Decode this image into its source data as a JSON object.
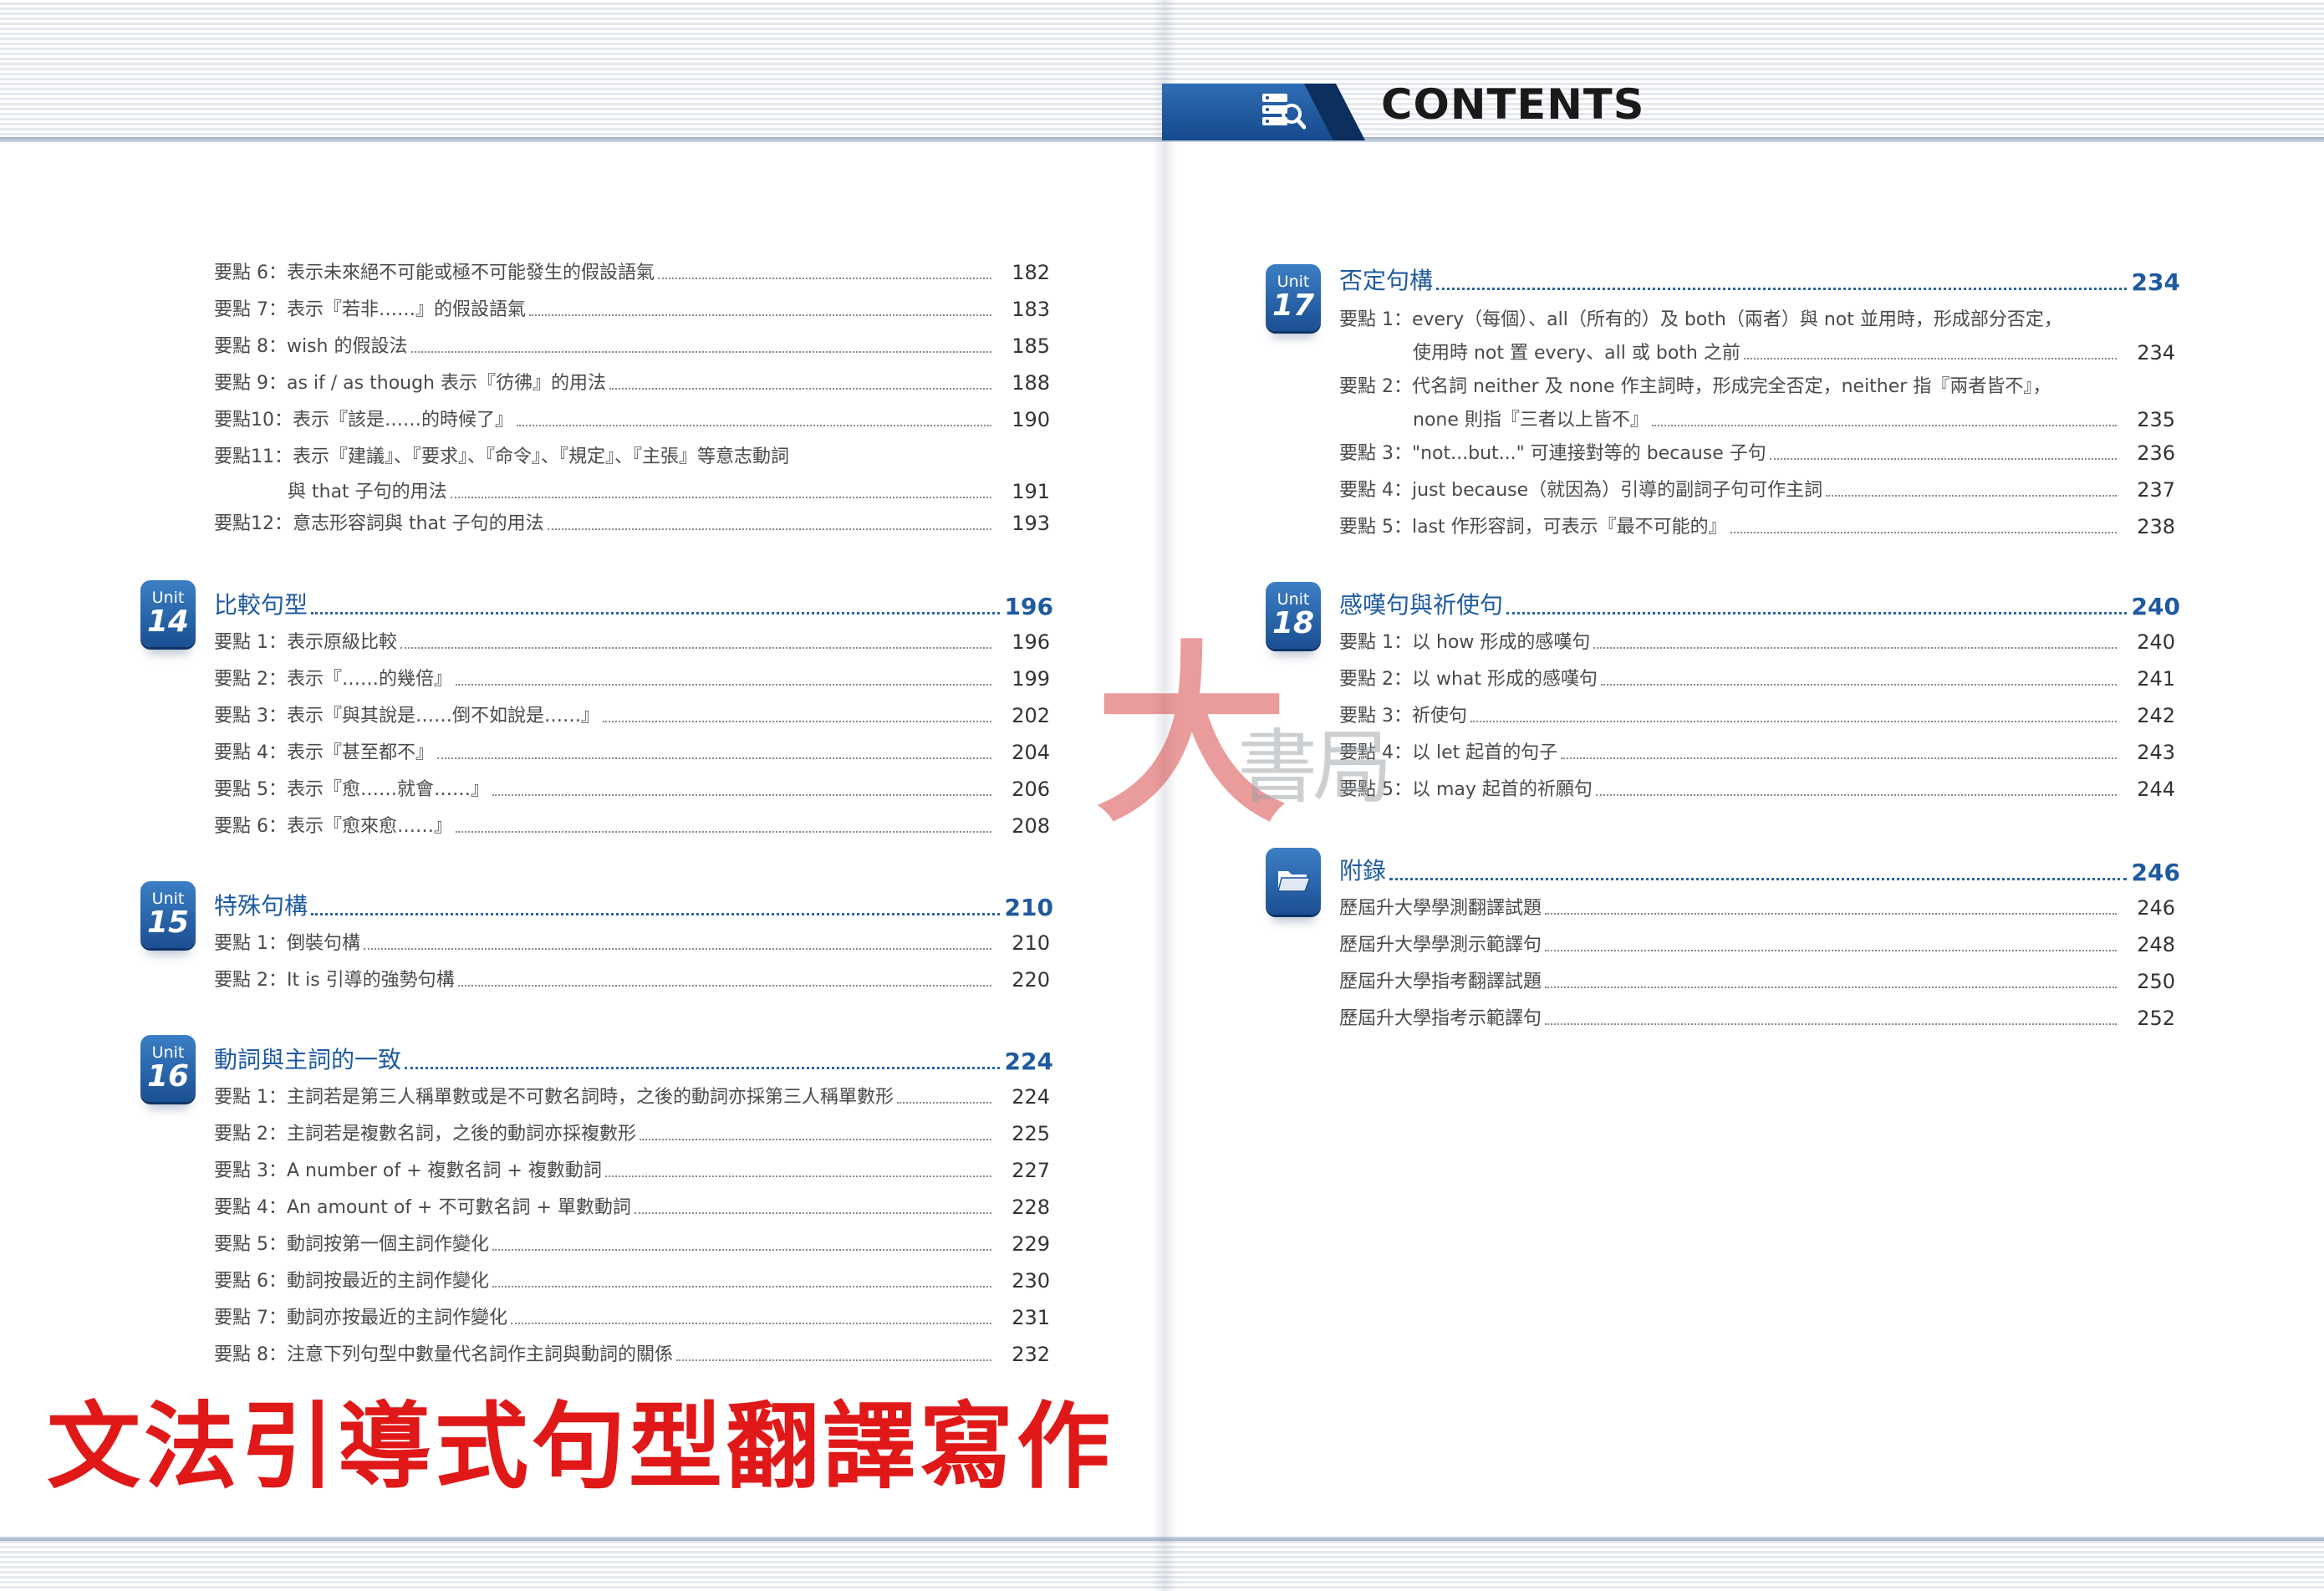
{
  "header": {
    "title": "CONTENTS"
  },
  "left_column": {
    "continuation": [
      {
        "label": "要點 6：表示未來絕不可能或極不可能發生的假設語氣",
        "page": "182"
      },
      {
        "label": "要點 7：表示『若非……』的假設語氣",
        "page": "183"
      },
      {
        "label": "要點 8：wish 的假設法",
        "page": "185"
      },
      {
        "label": "要點 9：as if / as though 表示『彷彿』的用法",
        "page": "188"
      },
      {
        "label": "要點10：表示『該是……的時候了』",
        "page": "190"
      },
      {
        "label": "要點11：表示『建議』、『要求』、『命令』、『規定』、『主張』等意志動詞",
        "page": ""
      },
      {
        "label": "與 that 子句的用法",
        "page": "191"
      },
      {
        "label": "要點12：意志形容詞與 that 子句的用法",
        "page": "193"
      }
    ],
    "units": [
      {
        "unit": "Unit",
        "number": "14",
        "title": "比較句型",
        "page": "196",
        "items": [
          {
            "label": "要點 1：表示原級比較",
            "page": "196"
          },
          {
            "label": "要點 2：表示『……的幾倍』",
            "page": "199"
          },
          {
            "label": "要點 3：表示『與其說是……倒不如說是……』",
            "page": "202"
          },
          {
            "label": "要點 4：表示『甚至都不』",
            "page": "204"
          },
          {
            "label": "要點 5：表示『愈……就會……』",
            "page": "206"
          },
          {
            "label": "要點 6：表示『愈來愈……』",
            "page": "208"
          }
        ]
      },
      {
        "unit": "Unit",
        "number": "15",
        "title": "特殊句構",
        "page": "210",
        "items": [
          {
            "label": "要點 1：倒裝句構",
            "page": "210"
          },
          {
            "label": "要點 2：It is 引導的強勢句構",
            "page": "220"
          }
        ]
      },
      {
        "unit": "Unit",
        "number": "16",
        "title": "動詞與主詞的一致",
        "page": "224",
        "items": [
          {
            "label": "要點 1：主詞若是第三人稱單數或是不可數名詞時，之後的動詞亦採第三人稱單數形",
            "page": "224"
          },
          {
            "label": "要點 2：主詞若是複數名詞，之後的動詞亦採複數形",
            "page": "225"
          },
          {
            "label": "要點 3：A number of + 複數名詞 + 複數動詞",
            "page": "227"
          },
          {
            "label": "要點 4：An amount of + 不可數名詞 + 單數動詞",
            "page": "228"
          },
          {
            "label": "要點 5：動詞按第一個主詞作變化",
            "page": "229"
          },
          {
            "label": "要點 6：動詞按最近的主詞作變化",
            "page": "230"
          },
          {
            "label": "要點 7：動詞亦按最近的主詞作變化",
            "page": "231"
          },
          {
            "label": "要點 8：注意下列句型中數量代名詞作主詞與動詞的關係",
            "page": "232"
          }
        ]
      }
    ]
  },
  "right_column": {
    "units": [
      {
        "unit": "Unit",
        "number": "17",
        "title": "否定句構",
        "page": "234",
        "items": [
          {
            "label": "要點 1：every（每個）、all（所有的）及 both（兩者）與 not 並用時，形成部分否定，",
            "page": ""
          },
          {
            "label": "使用時 not 置 every、all 或 both 之前",
            "page": "234"
          },
          {
            "label": "要點 2：代名詞 neither 及 none 作主詞時，形成完全否定，neither 指『兩者皆不』，",
            "page": ""
          },
          {
            "label": "none 則指『三者以上皆不』",
            "page": "235"
          },
          {
            "label": "要點 3：\"not...but...\" 可連接對等的 because 子句",
            "page": "236"
          },
          {
            "label": "要點 4：just because（就因為）引導的副詞子句可作主詞",
            "page": "237"
          },
          {
            "label": "要點 5：last 作形容詞，可表示『最不可能的』",
            "page": "238"
          }
        ]
      },
      {
        "unit": "Unit",
        "number": "18",
        "title": "感嘆句與祈使句",
        "page": "240",
        "items": [
          {
            "label": "要點 1：以 how 形成的感嘆句",
            "page": "240"
          },
          {
            "label": "要點 2：以 what 形成的感嘆句",
            "page": "241"
          },
          {
            "label": "要點 3：祈使句",
            "page": "242"
          },
          {
            "label": "要點 4：以 let 起首的句子",
            "page": "243"
          },
          {
            "label": "要點 5：以 may 起首的祈願句",
            "page": "244"
          }
        ]
      },
      {
        "unit": "",
        "number": "",
        "icon": "folder-icon",
        "title": "附錄",
        "page": "246",
        "items": [
          {
            "label": "歷屆升大學學測翻譯試題",
            "page": "246"
          },
          {
            "label": "歷屆升大學學測示範譯句",
            "page": "248"
          },
          {
            "label": "歷屆升大學指考翻譯試題",
            "page": "250"
          },
          {
            "label": "歷屆升大學指考示範譯句",
            "page": "252"
          }
        ]
      }
    ]
  },
  "watermark": {
    "big_char": "大",
    "text": "書局"
  },
  "caption": "文法引導式句型翻譯寫作",
  "colors": {
    "accent": "#1f5aa0",
    "badge": "#2a6ab0",
    "caption": "#e01818",
    "watermark": "#d94a4a"
  }
}
